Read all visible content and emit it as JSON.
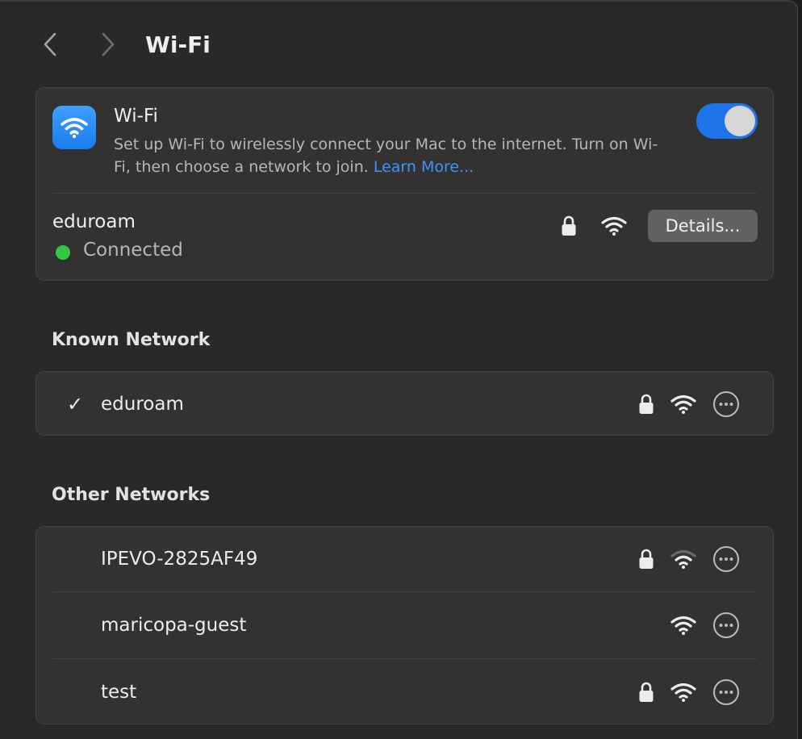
{
  "toolbar": {
    "back_icon": "chevron-left-icon",
    "forward_icon": "chevron-right-icon",
    "title": "Wi-Fi"
  },
  "wifi": {
    "title": "Wi-Fi",
    "description": "Set up Wi-Fi to wirelessly connect your Mac to the internet. Turn on Wi-Fi, then choose a network to join.",
    "learn_more": "Learn More...",
    "enabled": true,
    "accent_color": "#1f74ea"
  },
  "current_network": {
    "name": "eduroam",
    "status": "Connected",
    "status_color": "#33c748",
    "secured": true,
    "details_label": "Details..."
  },
  "known": {
    "heading": "Known Network",
    "networks": [
      {
        "name": "eduroam",
        "checked": true,
        "secured": true,
        "signal": "full"
      }
    ]
  },
  "other": {
    "heading": "Other Networks",
    "networks": [
      {
        "name": "IPEVO-2825AF49",
        "secured": true,
        "signal": "weak"
      },
      {
        "name": "maricopa-guest",
        "secured": false,
        "signal": "full"
      },
      {
        "name": "test",
        "secured": true,
        "signal": "full"
      }
    ]
  }
}
